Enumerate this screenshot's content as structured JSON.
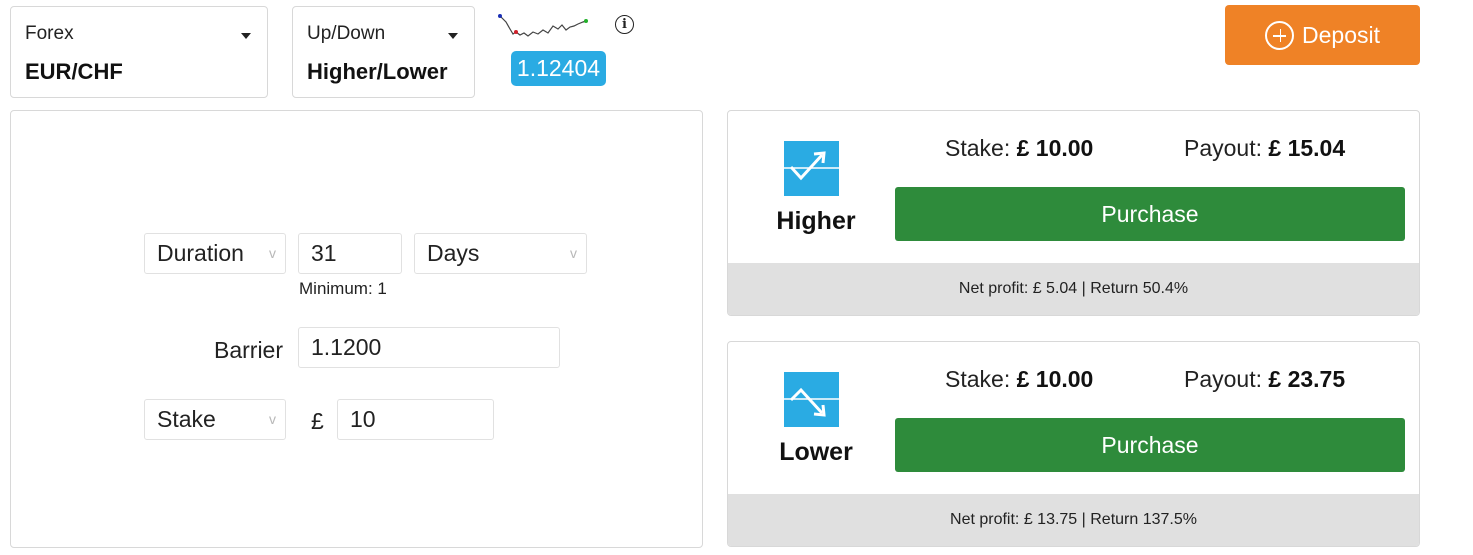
{
  "market_selector": {
    "label": "Forex",
    "value": "EUR/CHF"
  },
  "type_selector": {
    "label": "Up/Down",
    "value": "Higher/Lower"
  },
  "spot": {
    "price": "1.12404"
  },
  "info_icon": {
    "glyph": "i"
  },
  "deposit": {
    "label": "Deposit"
  },
  "params": {
    "duration_type": "Duration",
    "duration_value": "31",
    "duration_unit": "Days",
    "duration_min": "Minimum: 1",
    "barrier_label": "Barrier",
    "barrier_value": "1.1200",
    "amount_type": "Stake",
    "currency_symbol": "£",
    "amount_value": "10",
    "caret": "v"
  },
  "contracts": [
    {
      "name": "Higher",
      "stake_label": "Stake:",
      "stake": "£ 10.00",
      "payout_label": "Payout:",
      "payout": "£ 15.04",
      "button": "Purchase",
      "net": "Net profit: £ 5.04 | Return 50.4%"
    },
    {
      "name": "Lower",
      "stake_label": "Stake:",
      "stake": "£ 10.00",
      "payout_label": "Payout:",
      "payout": "£ 23.75",
      "button": "Purchase",
      "net": "Net profit: £ 13.75 | Return 137.5%"
    }
  ],
  "colors": {
    "accent_blue": "#2aabe3",
    "deposit_orange": "#ef8226",
    "purchase_green": "#2e8b3b",
    "footer_gray": "#e0e0e0"
  },
  "icons": {
    "higher": "arrow-up-right-icon",
    "lower": "arrow-down-right-icon",
    "deposit": "plus-circle-icon",
    "info": "info-icon"
  }
}
